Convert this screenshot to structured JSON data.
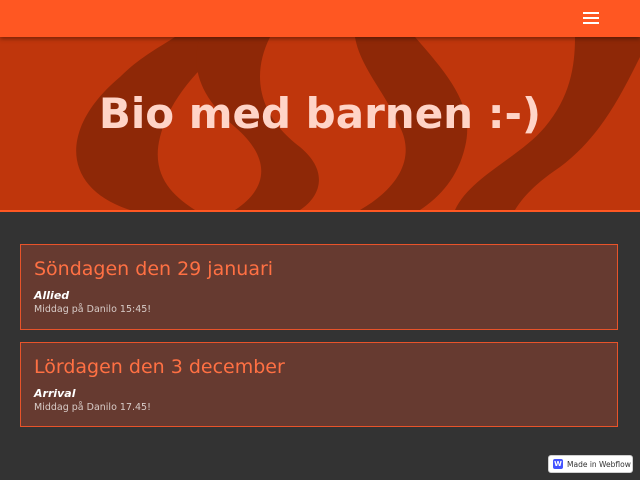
{
  "header": {
    "menu_icon": "hamburger-menu-icon",
    "accent_color": "#ff5722"
  },
  "hero": {
    "title": "Bio med barnen :-)",
    "background_color": "#bf360c"
  },
  "events": [
    {
      "date": "Söndagen den 29 januari",
      "movie": "Allied",
      "note": "Middag på Danilo 15:45!"
    },
    {
      "date": "Lördagen den 3 december",
      "movie": "Arrival",
      "note": "Middag på Danilo 17.45!"
    }
  ],
  "badge": {
    "logo_letter": "W",
    "label": "Made in Webflow"
  }
}
